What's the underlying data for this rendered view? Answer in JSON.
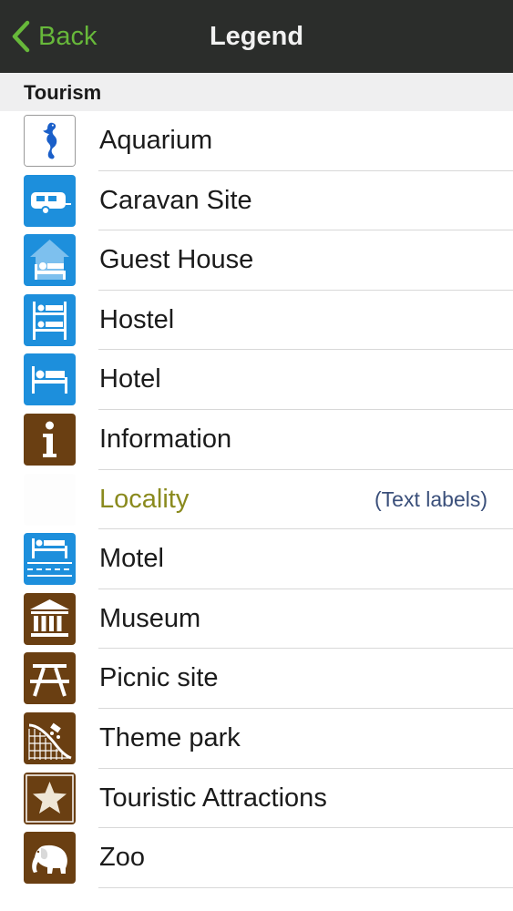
{
  "nav": {
    "back_label": "Back",
    "title": "Legend",
    "accent_color": "#67b83a",
    "back_icon": "chevron-left-icon"
  },
  "section": {
    "title": "Tourism"
  },
  "items": [
    {
      "label": "Aquarium",
      "icon": "seahorse-icon"
    },
    {
      "label": "Caravan Site",
      "icon": "caravan-icon"
    },
    {
      "label": "Guest House",
      "icon": "guest-house-icon"
    },
    {
      "label": "Hostel",
      "icon": "hostel-icon"
    },
    {
      "label": "Hotel",
      "icon": "hotel-icon"
    },
    {
      "label": "Information",
      "icon": "information-icon"
    },
    {
      "label": "Locality",
      "sublabel": "(Text labels)",
      "icon": "blank-icon",
      "label_color": "#8a8a1e"
    },
    {
      "label": "Motel",
      "icon": "motel-icon"
    },
    {
      "label": "Museum",
      "icon": "museum-icon"
    },
    {
      "label": "Picnic site",
      "icon": "picnic-table-icon"
    },
    {
      "label": "Theme park",
      "icon": "roller-coaster-icon"
    },
    {
      "label": "Touristic Attractions",
      "icon": "star-icon"
    },
    {
      "label": "Zoo",
      "icon": "elephant-icon"
    }
  ],
  "colors": {
    "blue_icon": "#1d8fdc",
    "brown_icon": "#6a3f12"
  }
}
